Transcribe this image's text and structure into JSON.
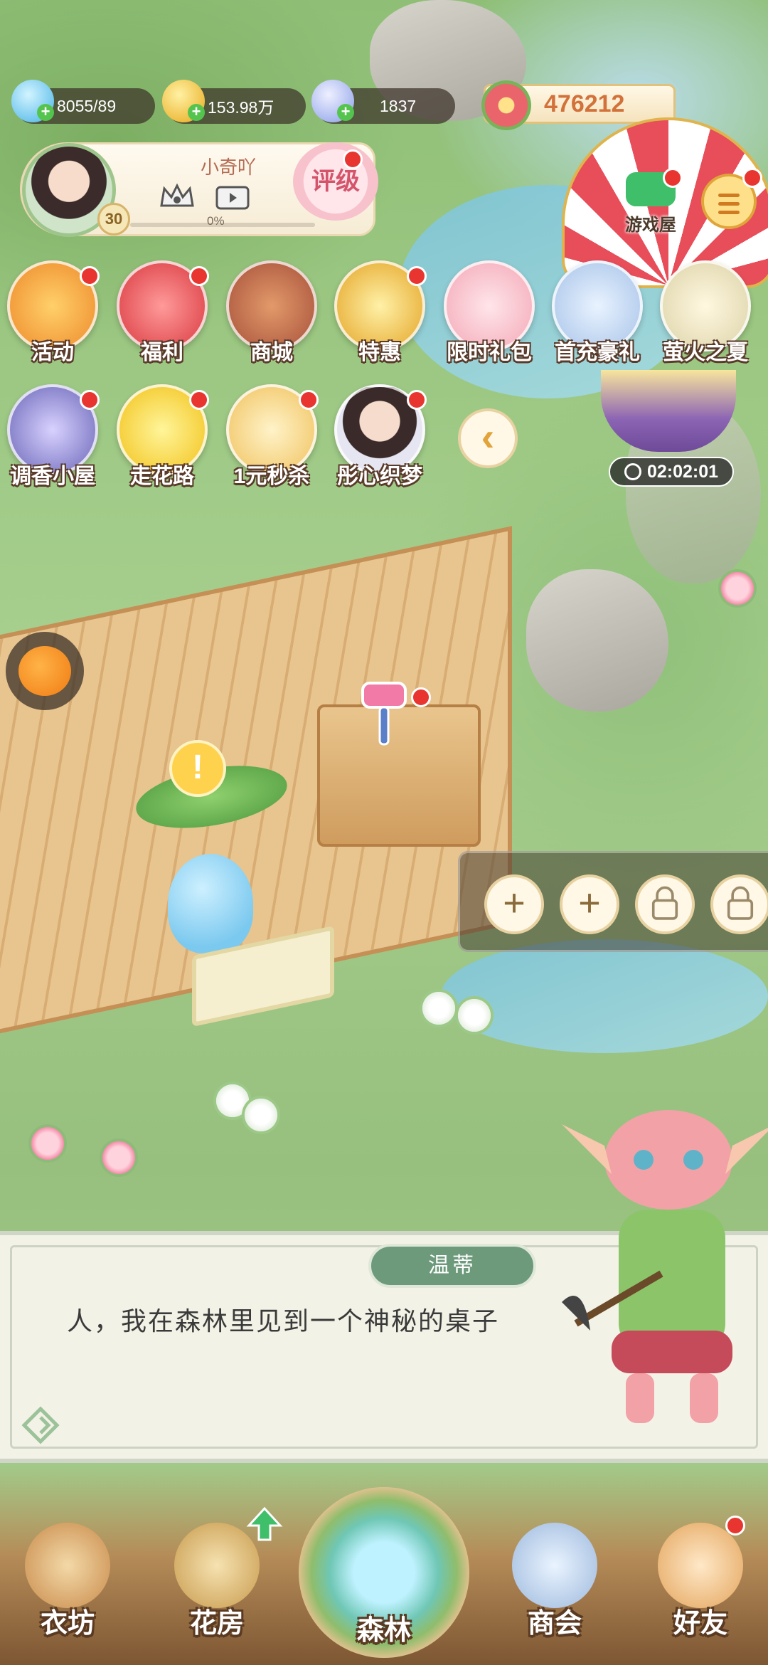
{
  "resources": {
    "water": "8055/89",
    "coins": "153.98万",
    "crystals": "1837",
    "flowers": "476212"
  },
  "profile": {
    "name": "小奇吖",
    "level": "30",
    "progress_text": "0%",
    "progress_value": 0,
    "rating_label": "评级"
  },
  "events_row1": [
    "活动",
    "福利",
    "商城",
    "特惠",
    "限时礼包",
    "首充豪礼",
    "萤火之夏"
  ],
  "events_row2": [
    "调香小屋",
    "走花路",
    "1元秒杀",
    "彤心织梦"
  ],
  "game_house": {
    "label": "游戏屋"
  },
  "firefly": {
    "timer": "02:02:01"
  },
  "slots": [
    "+",
    "+",
    "locked",
    "locked"
  ],
  "dialog": {
    "speaker": "温蒂",
    "text": "人，我在森林里见到一个神秘的桌子"
  },
  "bottom_nav": [
    "衣坊",
    "花房",
    "森林",
    "商会",
    "好友"
  ],
  "colors": {
    "accent_red_dot": "#e8352f",
    "flower_counter": "#d2713a",
    "speaker_badge": "#6d9a7b"
  }
}
